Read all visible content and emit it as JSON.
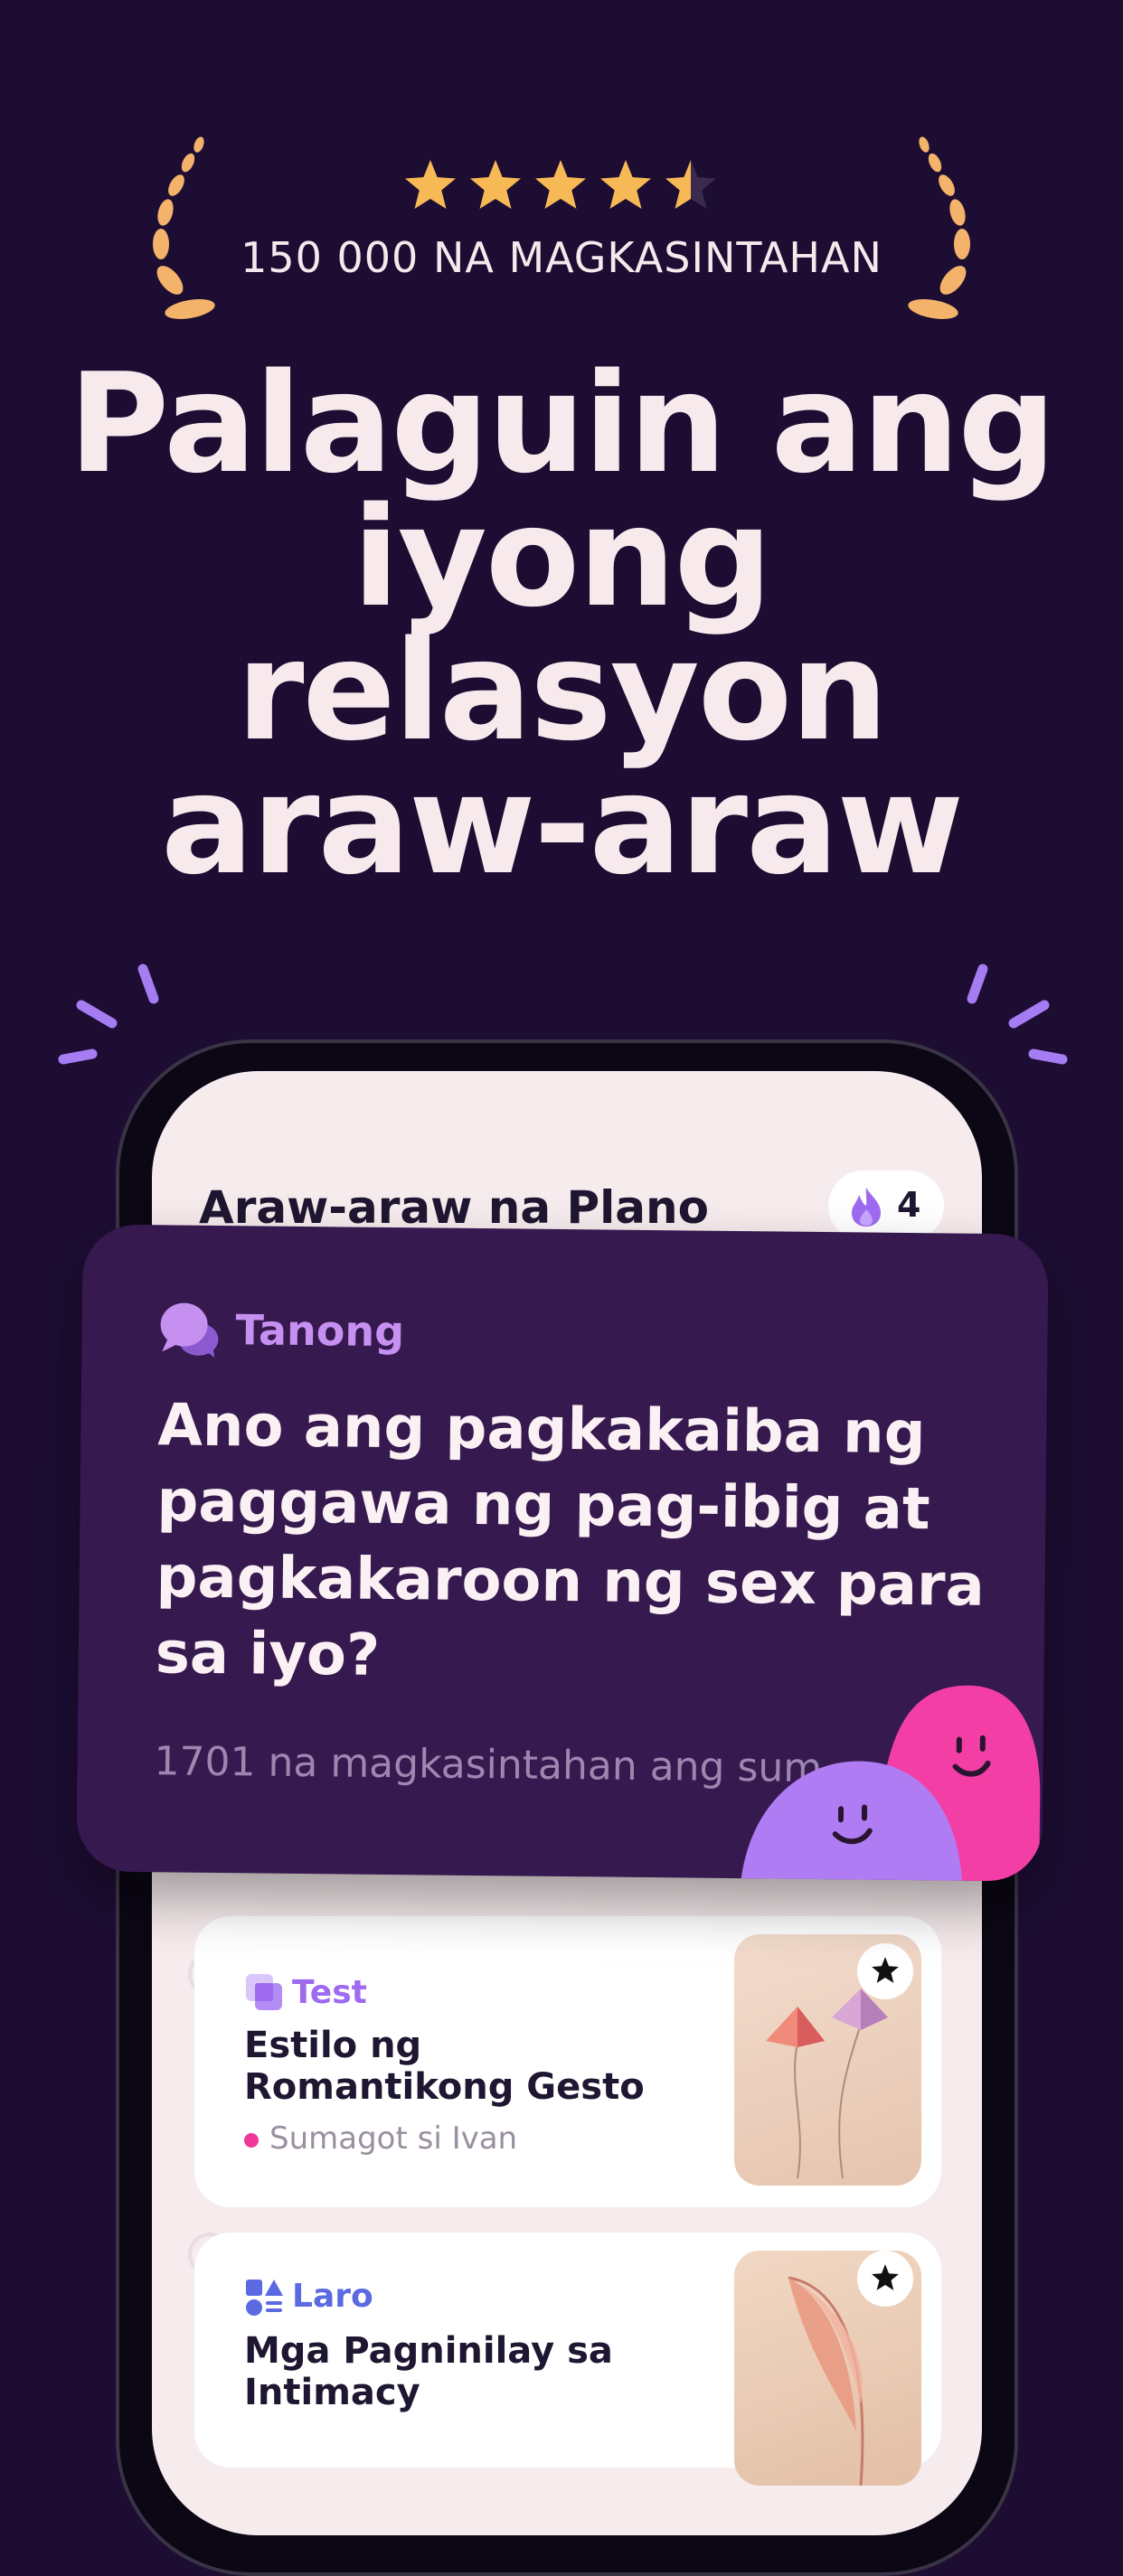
{
  "colors": {
    "background": "#1d0d33",
    "headline": "#f8eaec",
    "laurel": "#f4b36a",
    "star": "#f7b955",
    "accent_purple": "#9e6bf0",
    "card_purple": "#36194f",
    "tag_lilac": "#c690f0",
    "pink": "#f0389b"
  },
  "rating": {
    "stars_value": 4.5,
    "stars_max": 5,
    "caption": "150 000 NA MAGKASINTAHAN"
  },
  "headline": "Palaguin ang iyong relasyon araw-araw",
  "app": {
    "screen_title": "Araw-araw na Plano",
    "streak": {
      "icon": "flame-icon",
      "count": "4"
    }
  },
  "question_card": {
    "tag_icon": "chat-bubbles-icon",
    "tag": "Tanong",
    "question": "Ano ang pagkakaiba ng paggawa ng pag-ibig at pagkakaroon ng sex para sa iyo?",
    "answered_count": "1701 na magkasintahan ang sum"
  },
  "plan_items": [
    {
      "tag_icon": "test-icon",
      "tag": "Test",
      "tag_color": "#9e6bf0",
      "title": "Estilo ng Romantikong Gesto",
      "status": "Sumagot si Ivan",
      "thumbnail": "kites-image",
      "bookmark_icon": "star-icon"
    },
    {
      "tag_icon": "shapes-icon",
      "tag": "Laro",
      "tag_color": "#5b6ae0",
      "title": "Mga Pagninilay sa Intimacy",
      "thumbnail": "feather-image",
      "bookmark_icon": "star-icon"
    }
  ]
}
